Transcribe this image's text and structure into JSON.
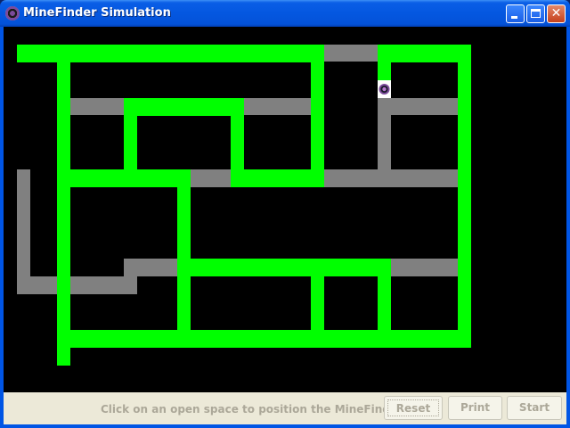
{
  "window": {
    "title": "MineFinder Simulation"
  },
  "colors": {
    "wall": "#00ff00",
    "visited": "#808080",
    "background": "#000000",
    "robot_ring": "#7b4b9a"
  },
  "status": {
    "message": "Click on an open space to position the MineFinder"
  },
  "buttons": {
    "reset": "Reset",
    "print": "Print",
    "start": "Start"
  },
  "icons": {
    "app": "minefinder-icon",
    "minimize": "minimize-icon",
    "maximize": "maximize-icon",
    "close": "close-icon"
  }
}
